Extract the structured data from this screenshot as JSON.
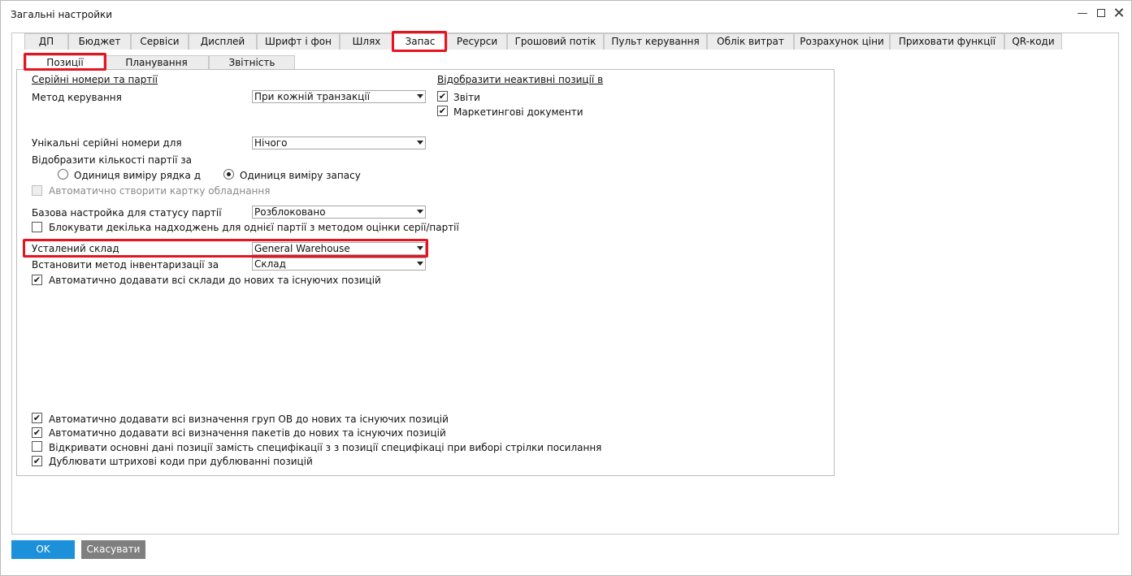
{
  "window": {
    "title": "Загальні настройки",
    "minimize": "—",
    "maximize": "",
    "close": "✕"
  },
  "tabs": [
    {
      "label": "ДП"
    },
    {
      "label": "Бюджет"
    },
    {
      "label": "Сервіси"
    },
    {
      "label": "Дисплей"
    },
    {
      "label": "Шрифт і фон"
    },
    {
      "label": "Шлях"
    },
    {
      "label": "Запас",
      "active": true
    },
    {
      "label": "Ресурси"
    },
    {
      "label": "Грошовий потік"
    },
    {
      "label": "Пульт керування"
    },
    {
      "label": "Облік витрат"
    },
    {
      "label": "Розрахунок ціни"
    },
    {
      "label": "Приховати функції"
    },
    {
      "label": "QR-коди"
    }
  ],
  "subtabs": [
    {
      "label": "Позиції",
      "active": true
    },
    {
      "label": "Планування"
    },
    {
      "label": "Звітність"
    }
  ],
  "left": {
    "serial_heading": "Серійні номери та партії",
    "method_label": "Метод керування",
    "method_value": "При кожній транзакції",
    "unique_label": "Унікальні серійні номери для",
    "unique_value": "Нічого",
    "batch_qty_label": "Відобразити кількості партії за",
    "radio_row_unit": "Одиниця виміру рядка доку",
    "radio_stock_unit": "Одиниця виміру запасу",
    "auto_equipment": "Автоматично створити картку обладнання",
    "batch_status_label": "Базова настройка для статусу партії",
    "batch_status_value": "Розблоковано",
    "block_receipts": "Блокувати декілька надходжень для однієї партії з методом оцінки серії/партії",
    "default_wh_label": "Усталений склад",
    "default_wh_value": "General Warehouse",
    "inventory_method_label": "Встановити метод інвентаризації за",
    "inventory_method_value": "Склад",
    "auto_add_warehouses": "Автоматично додавати всі склади до нових та існуючих позицій"
  },
  "right": {
    "inactive_heading": "Відобразити неактивні позиції в",
    "reports": "Звіти",
    "marketing_docs": "Маркетингові документи"
  },
  "bottom": {
    "auto_groups": "Автоматично додавати всі визначення груп ОВ до нових та існуючих позицій",
    "auto_packages": "Автоматично додавати всі визначення пакетів до нових та існуючих позицій",
    "open_master": "Відкривати основні дані позиції замість специфікації з з позиції специфікаці при виборі стрілки посилання",
    "dup_barcodes": "Дублювати штрихові коди при дублюванні позицій"
  },
  "buttons": {
    "ok": "OK",
    "cancel": "Скасувати"
  },
  "colors": {
    "highlight": "#e8131f",
    "ok_button": "#1c90d8",
    "cancel_button": "#7f7f7f"
  },
  "checks": {
    "reports": true,
    "marketing_docs": true,
    "auto_equipment": false,
    "block_receipts": false,
    "auto_add_warehouses": true,
    "auto_groups": true,
    "auto_packages": true,
    "open_master": false,
    "dup_barcodes": true,
    "radio_selected": "stock_unit"
  }
}
